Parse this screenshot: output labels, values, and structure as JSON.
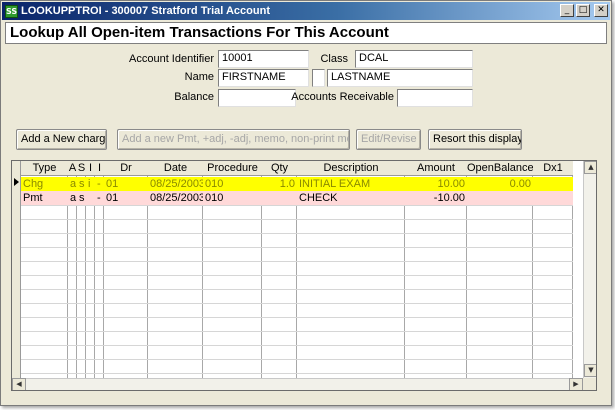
{
  "window": {
    "title": "LOOKUPPTROI - 300007 Stratford Trial Account",
    "app_icon_text": "SS",
    "controls": {
      "minimize": "_",
      "maximize": "□",
      "close": "✕"
    }
  },
  "header": {
    "title": "Lookup All Open-item Transactions For This Account"
  },
  "form": {
    "account_identifier_label": "Account Identifier",
    "account_identifier_value": "10001",
    "class_label": "Class",
    "class_value": "DCAL",
    "name_label": "Name",
    "first_name_value": "FIRSTNAME",
    "middle_initial_value": "",
    "last_name_value": "LASTNAME",
    "balance_label": "Balance",
    "balance_value": "",
    "accounts_receivable_label": "Accounts Receivable",
    "accounts_receivable_value": ""
  },
  "toolbar": {
    "add_charge_label": "Add a New charge",
    "add_payment_label": "Add a new Pmt, +adj, -adj, memo, non-print memo",
    "edit_revise_label": "Edit/Revise",
    "resort_label": "Resort this display"
  },
  "grid": {
    "columns": [
      "Type",
      "A",
      "S",
      "I",
      "I",
      "Dr",
      "Date",
      "Procedure",
      "Qty",
      "Description",
      "Amount",
      "OpenBalance",
      "Dx1"
    ],
    "rows": [
      {
        "type": "Chg",
        "a": "a",
        "s": "s",
        "i1": "i",
        "i2": "-",
        "dr": "01",
        "date": "08/25/2003",
        "procedure": "010",
        "qty": "1.0",
        "description": "INITIAL EXAM",
        "amount": "10.00",
        "open_balance": "0.00",
        "dx1": "",
        "selected": true
      },
      {
        "type": "Pmt",
        "a": "a",
        "s": "s",
        "i1": "",
        "i2": "-",
        "dr": "01",
        "date": "08/25/2003",
        "procedure": "010",
        "qty": "",
        "description": "CHECK",
        "amount": "-10.00",
        "open_balance": "",
        "dx1": "",
        "selected": false
      }
    ],
    "colors": {
      "selected_row_bg": "#ffff00",
      "selected_row_text": "#8a8a00",
      "row_bg": "#ffd9d9"
    }
  }
}
